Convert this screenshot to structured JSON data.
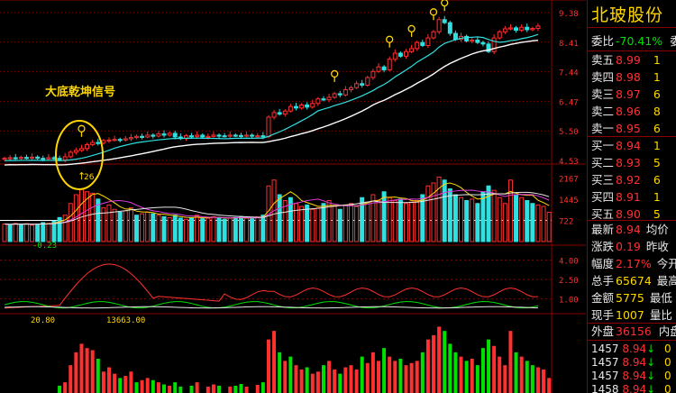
{
  "colors": {
    "up": "#ff3030",
    "down": "#30e0e0",
    "ma1": "#30e0e0",
    "ma2": "#ffffff",
    "yellow": "#ffd700",
    "magenta": "#e040e0",
    "green": "#00e000",
    "grid": "#8a0000"
  },
  "annotations": {
    "signal_label": "大底乾坤信号",
    "arrow_label": "26",
    "macd_low": "-0.23",
    "osc_left": "20.80",
    "osc_right": "13663.00"
  },
  "chart_data": [
    {
      "type": "candlestick",
      "panel": "price",
      "y_ticks": [
        "9.38",
        "8.41",
        "7.44",
        "6.47",
        "5.50",
        "4.53"
      ],
      "ylim": [
        4.53,
        9.38
      ],
      "close": [
        4.6,
        4.62,
        4.6,
        4.63,
        4.61,
        4.64,
        4.6,
        4.58,
        4.62,
        4.6,
        4.55,
        4.65,
        4.8,
        4.86,
        4.92,
        5.05,
        5.12,
        5.1,
        5.18,
        5.2,
        5.22,
        5.2,
        5.24,
        5.28,
        5.32,
        5.3,
        5.36,
        5.33,
        5.4,
        5.36,
        5.42,
        5.3,
        5.25,
        5.34,
        5.32,
        5.36,
        5.3,
        5.32,
        5.36,
        5.34,
        5.33,
        5.36,
        5.35,
        5.34,
        5.36,
        5.33,
        5.34,
        5.31,
        5.95,
        6.1,
        6.05,
        6.15,
        6.3,
        6.25,
        6.35,
        6.28,
        6.4,
        6.55,
        6.52,
        6.6,
        6.72,
        6.68,
        6.85,
        6.92,
        7.05,
        7.0,
        7.25,
        7.45,
        7.6,
        7.5,
        7.85,
        8.05,
        7.95,
        8.1,
        8.2,
        8.4,
        8.3,
        8.55,
        8.75,
        9.15,
        9.05,
        8.7,
        8.5,
        8.6,
        8.45,
        8.48,
        8.4,
        8.35,
        8.1,
        8.55,
        8.75,
        8.85,
        8.88,
        8.8,
        8.9,
        8.82,
        8.86,
        8.94
      ],
      "signal_markers": [
        14,
        60,
        70,
        74,
        78,
        80
      ]
    },
    {
      "type": "bar",
      "panel": "volume",
      "y_ticks": [
        "2167",
        "1445",
        "722"
      ],
      "ylim": [
        0,
        2400
      ],
      "values": [
        600,
        580,
        620,
        590,
        610,
        560,
        600,
        650,
        620,
        700,
        820,
        900,
        1300,
        1600,
        1800,
        1700,
        1650,
        1450,
        1150,
        1250,
        1100,
        1000,
        1050,
        1150,
        900,
        950,
        1000,
        950,
        900,
        850,
        820,
        900,
        800,
        760,
        820,
        900,
        780,
        800,
        850,
        820,
        760,
        800,
        820,
        860,
        800,
        780,
        840,
        900,
        1900,
        2100,
        1600,
        1400,
        1500,
        1300,
        1200,
        1250,
        1100,
        1150,
        1300,
        1400,
        1200,
        1100,
        1250,
        1300,
        1200,
        1500,
        1350,
        1600,
        1400,
        1700,
        1500,
        1400,
        1450,
        1300,
        1350,
        1400,
        1600,
        1900,
        2000,
        2200,
        2100,
        1800,
        1600,
        1500,
        1400,
        1450,
        1300,
        1700,
        1900,
        1750,
        1500,
        1300,
        2100,
        1600,
        1500,
        1400,
        1300,
        1250,
        1200,
        1000
      ],
      "down_days": [
        1,
        3,
        6,
        7,
        9,
        10,
        17,
        21,
        24,
        27,
        29,
        31,
        32,
        34,
        36,
        39,
        40,
        42,
        43,
        45,
        47,
        50,
        52,
        55,
        58,
        61,
        65,
        69,
        72,
        76,
        80,
        81,
        82,
        84,
        86,
        87,
        88,
        93,
        95,
        96
      ]
    },
    {
      "type": "line",
      "panel": "oscillator",
      "y_ticks": [
        "4.00",
        "2.50",
        "1.00"
      ],
      "ylim": [
        0,
        4.6
      ]
    },
    {
      "type": "bar",
      "panel": "volume-ratio",
      "ylim": [
        0,
        4
      ]
    }
  ],
  "side": {
    "title": "北玻股份",
    "weibi": {
      "label": "委比",
      "value": "-70.41%",
      "extra": "委差"
    },
    "sell": [
      {
        "label": "卖五",
        "price": "8.99",
        "vol": "1"
      },
      {
        "label": "卖四",
        "price": "8.98",
        "vol": "1"
      },
      {
        "label": "卖三",
        "price": "8.97",
        "vol": "6"
      },
      {
        "label": "卖二",
        "price": "8.96",
        "vol": "8"
      },
      {
        "label": "卖一",
        "price": "8.95",
        "vol": "6"
      }
    ],
    "buy": [
      {
        "label": "买一",
        "price": "8.94",
        "vol": "1"
      },
      {
        "label": "买二",
        "price": "8.93",
        "vol": "5"
      },
      {
        "label": "买三",
        "price": "8.92",
        "vol": "6"
      },
      {
        "label": "买四",
        "price": "8.91",
        "vol": "1"
      },
      {
        "label": "买五",
        "price": "8.90",
        "vol": "5"
      }
    ],
    "stats": [
      {
        "label": "最新",
        "value": "8.94",
        "cls": "red",
        "extra": "均价"
      },
      {
        "label": "涨跌",
        "value": "0.19",
        "cls": "red",
        "extra": "昨收"
      },
      {
        "label": "幅度",
        "value": "2.17%",
        "cls": "red",
        "extra": "今开"
      },
      {
        "label": "总手",
        "value": "65674",
        "cls": "yel",
        "extra": "最高"
      },
      {
        "label": "金额",
        "value": "5775",
        "cls": "yel",
        "extra": "最低"
      },
      {
        "label": "现手",
        "value": "1007",
        "cls": "yel",
        "extra": "量比"
      }
    ],
    "outer": {
      "label": "外盘",
      "value": "36156",
      "extra": "内盘"
    },
    "ticks": [
      {
        "time": "1457",
        "price": "8.94",
        "arrow": "↓",
        "vol": "0"
      },
      {
        "time": "1457",
        "price": "8.94",
        "arrow": "↓",
        "vol": "0"
      },
      {
        "time": "1457",
        "price": "8.94",
        "arrow": "↓",
        "vol": "0"
      },
      {
        "time": "1458",
        "price": "8.94",
        "arrow": "↓",
        "vol": "0"
      }
    ]
  }
}
